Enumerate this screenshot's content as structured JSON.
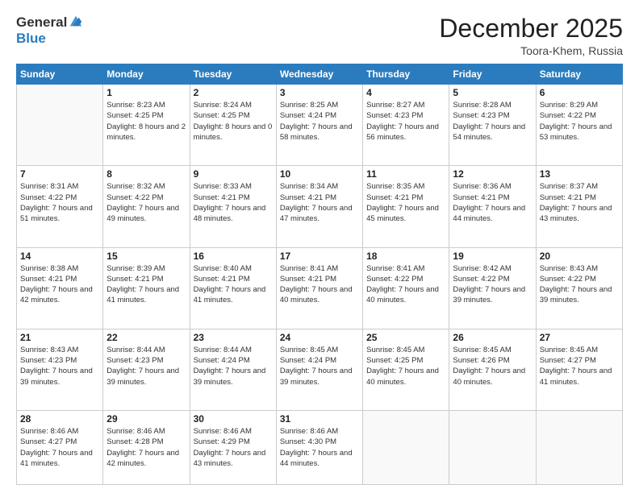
{
  "logo": {
    "general": "General",
    "blue": "Blue"
  },
  "title": "December 2025",
  "location": "Toora-Khem, Russia",
  "days_header": [
    "Sunday",
    "Monday",
    "Tuesday",
    "Wednesday",
    "Thursday",
    "Friday",
    "Saturday"
  ],
  "weeks": [
    [
      {
        "day": "",
        "sunrise": "",
        "sunset": "",
        "daylight": ""
      },
      {
        "day": "1",
        "sunrise": "Sunrise: 8:23 AM",
        "sunset": "Sunset: 4:25 PM",
        "daylight": "Daylight: 8 hours and 2 minutes."
      },
      {
        "day": "2",
        "sunrise": "Sunrise: 8:24 AM",
        "sunset": "Sunset: 4:25 PM",
        "daylight": "Daylight: 8 hours and 0 minutes."
      },
      {
        "day": "3",
        "sunrise": "Sunrise: 8:25 AM",
        "sunset": "Sunset: 4:24 PM",
        "daylight": "Daylight: 7 hours and 58 minutes."
      },
      {
        "day": "4",
        "sunrise": "Sunrise: 8:27 AM",
        "sunset": "Sunset: 4:23 PM",
        "daylight": "Daylight: 7 hours and 56 minutes."
      },
      {
        "day": "5",
        "sunrise": "Sunrise: 8:28 AM",
        "sunset": "Sunset: 4:23 PM",
        "daylight": "Daylight: 7 hours and 54 minutes."
      },
      {
        "day": "6",
        "sunrise": "Sunrise: 8:29 AM",
        "sunset": "Sunset: 4:22 PM",
        "daylight": "Daylight: 7 hours and 53 minutes."
      }
    ],
    [
      {
        "day": "7",
        "sunrise": "Sunrise: 8:31 AM",
        "sunset": "Sunset: 4:22 PM",
        "daylight": "Daylight: 7 hours and 51 minutes."
      },
      {
        "day": "8",
        "sunrise": "Sunrise: 8:32 AM",
        "sunset": "Sunset: 4:22 PM",
        "daylight": "Daylight: 7 hours and 49 minutes."
      },
      {
        "day": "9",
        "sunrise": "Sunrise: 8:33 AM",
        "sunset": "Sunset: 4:21 PM",
        "daylight": "Daylight: 7 hours and 48 minutes."
      },
      {
        "day": "10",
        "sunrise": "Sunrise: 8:34 AM",
        "sunset": "Sunset: 4:21 PM",
        "daylight": "Daylight: 7 hours and 47 minutes."
      },
      {
        "day": "11",
        "sunrise": "Sunrise: 8:35 AM",
        "sunset": "Sunset: 4:21 PM",
        "daylight": "Daylight: 7 hours and 45 minutes."
      },
      {
        "day": "12",
        "sunrise": "Sunrise: 8:36 AM",
        "sunset": "Sunset: 4:21 PM",
        "daylight": "Daylight: 7 hours and 44 minutes."
      },
      {
        "day": "13",
        "sunrise": "Sunrise: 8:37 AM",
        "sunset": "Sunset: 4:21 PM",
        "daylight": "Daylight: 7 hours and 43 minutes."
      }
    ],
    [
      {
        "day": "14",
        "sunrise": "Sunrise: 8:38 AM",
        "sunset": "Sunset: 4:21 PM",
        "daylight": "Daylight: 7 hours and 42 minutes."
      },
      {
        "day": "15",
        "sunrise": "Sunrise: 8:39 AM",
        "sunset": "Sunset: 4:21 PM",
        "daylight": "Daylight: 7 hours and 41 minutes."
      },
      {
        "day": "16",
        "sunrise": "Sunrise: 8:40 AM",
        "sunset": "Sunset: 4:21 PM",
        "daylight": "Daylight: 7 hours and 41 minutes."
      },
      {
        "day": "17",
        "sunrise": "Sunrise: 8:41 AM",
        "sunset": "Sunset: 4:21 PM",
        "daylight": "Daylight: 7 hours and 40 minutes."
      },
      {
        "day": "18",
        "sunrise": "Sunrise: 8:41 AM",
        "sunset": "Sunset: 4:22 PM",
        "daylight": "Daylight: 7 hours and 40 minutes."
      },
      {
        "day": "19",
        "sunrise": "Sunrise: 8:42 AM",
        "sunset": "Sunset: 4:22 PM",
        "daylight": "Daylight: 7 hours and 39 minutes."
      },
      {
        "day": "20",
        "sunrise": "Sunrise: 8:43 AM",
        "sunset": "Sunset: 4:22 PM",
        "daylight": "Daylight: 7 hours and 39 minutes."
      }
    ],
    [
      {
        "day": "21",
        "sunrise": "Sunrise: 8:43 AM",
        "sunset": "Sunset: 4:23 PM",
        "daylight": "Daylight: 7 hours and 39 minutes."
      },
      {
        "day": "22",
        "sunrise": "Sunrise: 8:44 AM",
        "sunset": "Sunset: 4:23 PM",
        "daylight": "Daylight: 7 hours and 39 minutes."
      },
      {
        "day": "23",
        "sunrise": "Sunrise: 8:44 AM",
        "sunset": "Sunset: 4:24 PM",
        "daylight": "Daylight: 7 hours and 39 minutes."
      },
      {
        "day": "24",
        "sunrise": "Sunrise: 8:45 AM",
        "sunset": "Sunset: 4:24 PM",
        "daylight": "Daylight: 7 hours and 39 minutes."
      },
      {
        "day": "25",
        "sunrise": "Sunrise: 8:45 AM",
        "sunset": "Sunset: 4:25 PM",
        "daylight": "Daylight: 7 hours and 40 minutes."
      },
      {
        "day": "26",
        "sunrise": "Sunrise: 8:45 AM",
        "sunset": "Sunset: 4:26 PM",
        "daylight": "Daylight: 7 hours and 40 minutes."
      },
      {
        "day": "27",
        "sunrise": "Sunrise: 8:45 AM",
        "sunset": "Sunset: 4:27 PM",
        "daylight": "Daylight: 7 hours and 41 minutes."
      }
    ],
    [
      {
        "day": "28",
        "sunrise": "Sunrise: 8:46 AM",
        "sunset": "Sunset: 4:27 PM",
        "daylight": "Daylight: 7 hours and 41 minutes."
      },
      {
        "day": "29",
        "sunrise": "Sunrise: 8:46 AM",
        "sunset": "Sunset: 4:28 PM",
        "daylight": "Daylight: 7 hours and 42 minutes."
      },
      {
        "day": "30",
        "sunrise": "Sunrise: 8:46 AM",
        "sunset": "Sunset: 4:29 PM",
        "daylight": "Daylight: 7 hours and 43 minutes."
      },
      {
        "day": "31",
        "sunrise": "Sunrise: 8:46 AM",
        "sunset": "Sunset: 4:30 PM",
        "daylight": "Daylight: 7 hours and 44 minutes."
      },
      {
        "day": "",
        "sunrise": "",
        "sunset": "",
        "daylight": ""
      },
      {
        "day": "",
        "sunrise": "",
        "sunset": "",
        "daylight": ""
      },
      {
        "day": "",
        "sunrise": "",
        "sunset": "",
        "daylight": ""
      }
    ]
  ]
}
